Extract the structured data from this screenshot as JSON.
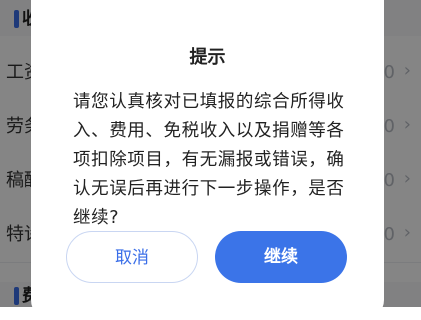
{
  "background": {
    "sections": [
      {
        "label": "收",
        "name": "section-income"
      },
      {
        "label": "费",
        "name": "section-fees"
      }
    ],
    "rows": [
      {
        "label": "工资",
        "value": "0"
      },
      {
        "label": "劳务",
        "value": "0"
      },
      {
        "label": "稿酬",
        "value": "0"
      },
      {
        "label": "特许",
        "value": "0"
      }
    ]
  },
  "dialog": {
    "title": "提示",
    "message": "请您认真核对已填报的综合所得收入、费用、免税收入以及捐赠等各项扣除项目，有无漏报或错误，确认无误后再进行下一步操作，是否继续?",
    "cancel_label": "取消",
    "continue_label": "继续"
  },
  "colors": {
    "accent": "#3b74e8",
    "mask": "rgba(0,0,0,0.48)"
  }
}
